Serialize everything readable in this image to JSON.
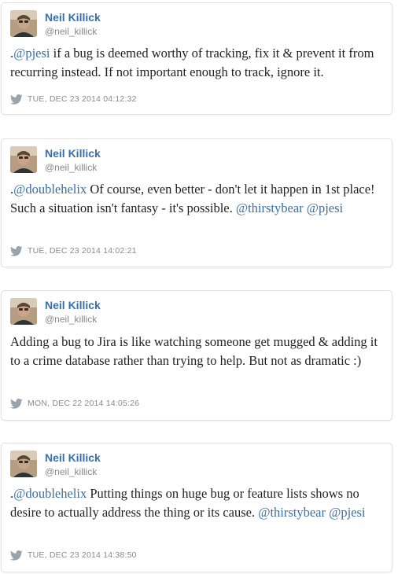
{
  "tweets": [
    {
      "author_name": "Neil Killick",
      "author_handle": "@neil_killick",
      "text_parts": [
        {
          "text": "."
        },
        {
          "text": "@pjesi",
          "mention": true
        },
        {
          "text": " if a bug is deemed worthy of tracking, fix it & prevent it from recurring instead. If not important enough to track, ignore it."
        }
      ],
      "timestamp": "TUE, DEC 23 2014 04:12:32"
    },
    {
      "author_name": "Neil Killick",
      "author_handle": "@neil_killick",
      "text_parts": [
        {
          "text": "."
        },
        {
          "text": "@doublehelix",
          "mention": true
        },
        {
          "text": " Of course, even better - don't let it happen in 1st place! Such a situation isn't fantasy - it's possible. "
        },
        {
          "text": "@thirstybear",
          "mention": true
        },
        {
          "text": " "
        },
        {
          "text": "@pjesi",
          "mention": true
        }
      ],
      "timestamp": "TUE, DEC 23 2014 14:02:21"
    },
    {
      "author_name": "Neil Killick",
      "author_handle": "@neil_killick",
      "text_parts": [
        {
          "text": "Adding a bug to Jira is like watching someone get mugged & adding it to a crime database rather than trying to help. But not as dramatic :)"
        }
      ],
      "timestamp": "MON, DEC 22 2014 14:05:26"
    },
    {
      "author_name": "Neil Killick",
      "author_handle": "@neil_killick",
      "text_parts": [
        {
          "text": "."
        },
        {
          "text": "@doublehelix",
          "mention": true
        },
        {
          "text": " Putting things on huge bug or feature lists shows no desire to actually address the thing or its cause. "
        },
        {
          "text": "@thirstybear",
          "mention": true
        },
        {
          "text": " "
        },
        {
          "text": "@pjesi",
          "mention": true
        }
      ],
      "timestamp": "TUE, DEC 23 2014 14:38:50"
    }
  ],
  "colors": {
    "author_name": "#3a6ea8",
    "mention": "#3a6ea8",
    "handle": "#888888",
    "timestamp": "#8a8a8a",
    "text": "#222222",
    "card_border": "#e1e1e1"
  },
  "icons": {
    "source": "twitter-bird-icon",
    "avatar": "avatar"
  }
}
